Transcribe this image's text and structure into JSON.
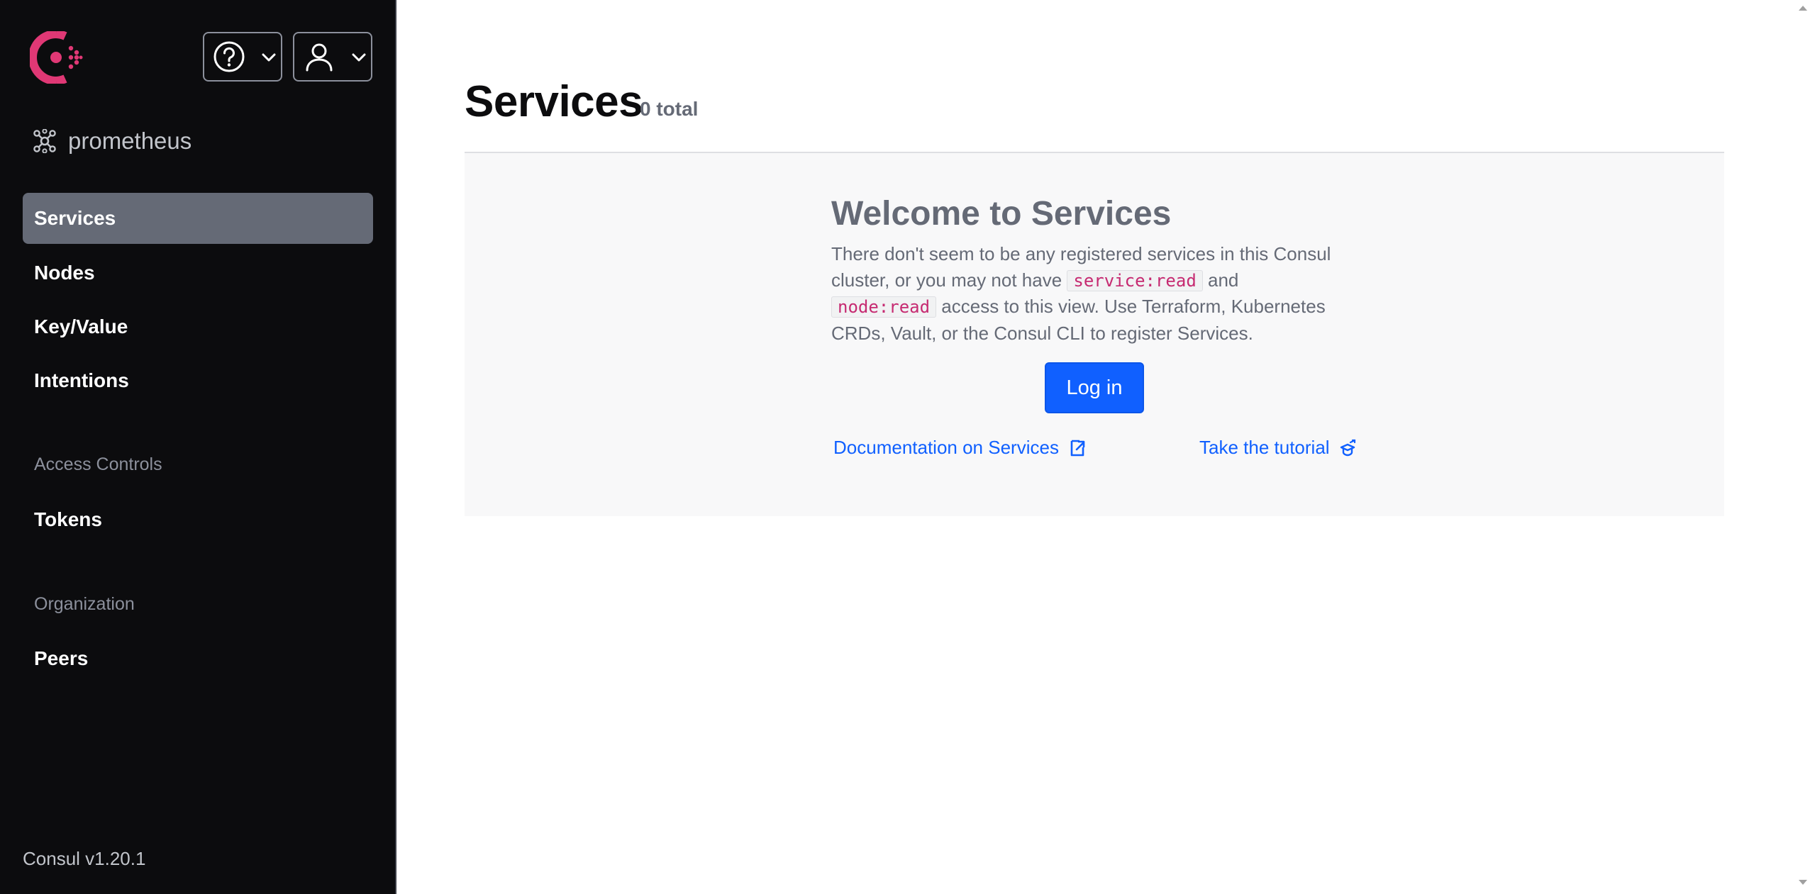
{
  "sidebar": {
    "logo_icon": "consul-logo-icon",
    "help_icon": "help-circle-icon",
    "user_icon": "user-icon",
    "datacenter": {
      "icon": "datacenter-icon",
      "label": "prometheus"
    },
    "nav": [
      {
        "label": "Services",
        "active": true
      },
      {
        "label": "Nodes",
        "active": false
      },
      {
        "label": "Key/Value",
        "active": false
      },
      {
        "label": "Intentions",
        "active": false
      }
    ],
    "sections": [
      {
        "title": "Access Controls",
        "items": [
          {
            "label": "Tokens"
          }
        ]
      },
      {
        "title": "Organization",
        "items": [
          {
            "label": "Peers"
          }
        ]
      }
    ],
    "version": "Consul v1.20.1"
  },
  "main": {
    "title": "Services",
    "count": "0 total",
    "empty_state": {
      "heading": "Welcome to Services",
      "text_1": "There don't seem to be any registered services in this Consul cluster, or you may not have ",
      "code_1": "service:read",
      "text_2": " and ",
      "code_2": "node:read",
      "text_3": " access to this view. Use Terraform, Kubernetes CRDs, Vault, or the Consul CLI to register Services.",
      "login_label": "Log in",
      "docs_link": "Documentation on Services",
      "docs_icon": "docs-link-icon",
      "tutorial_link": "Take the tutorial",
      "tutorial_icon": "learn-icon"
    }
  },
  "colors": {
    "sidebar_bg": "#0c0c0e",
    "active_item": "#656a76",
    "primary": "#1060ff",
    "brand": "#e03875",
    "code_text": "#c62a71"
  }
}
